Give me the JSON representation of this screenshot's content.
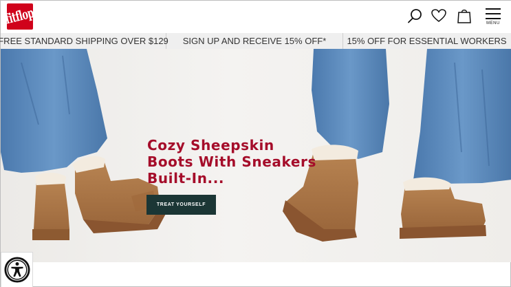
{
  "header": {
    "logo_text": "fitflop",
    "icons": [
      "search-icon",
      "heart-icon",
      "bag-icon",
      "hamburger-menu-icon"
    ],
    "menu_label": "MENU"
  },
  "promo_bar": {
    "items": [
      "FREE STANDARD SHIPPING OVER $129",
      "SIGN UP AND RECEIVE 15% OFF*",
      "15% OFF FOR ESSENTIAL WORKERS"
    ]
  },
  "hero": {
    "headline_lines": [
      "Cozy Sheepskin",
      "Boots With Sneakers",
      "Built-In..."
    ],
    "cta_label": "TREAT YOURSELF"
  },
  "accessibility": {
    "icon": "accessibility-icon"
  },
  "colors": {
    "brand_red": "#d0021b",
    "headline_red": "#a50d2a",
    "cta_bg": "#1b3635",
    "promo_bg": "#efefef"
  }
}
